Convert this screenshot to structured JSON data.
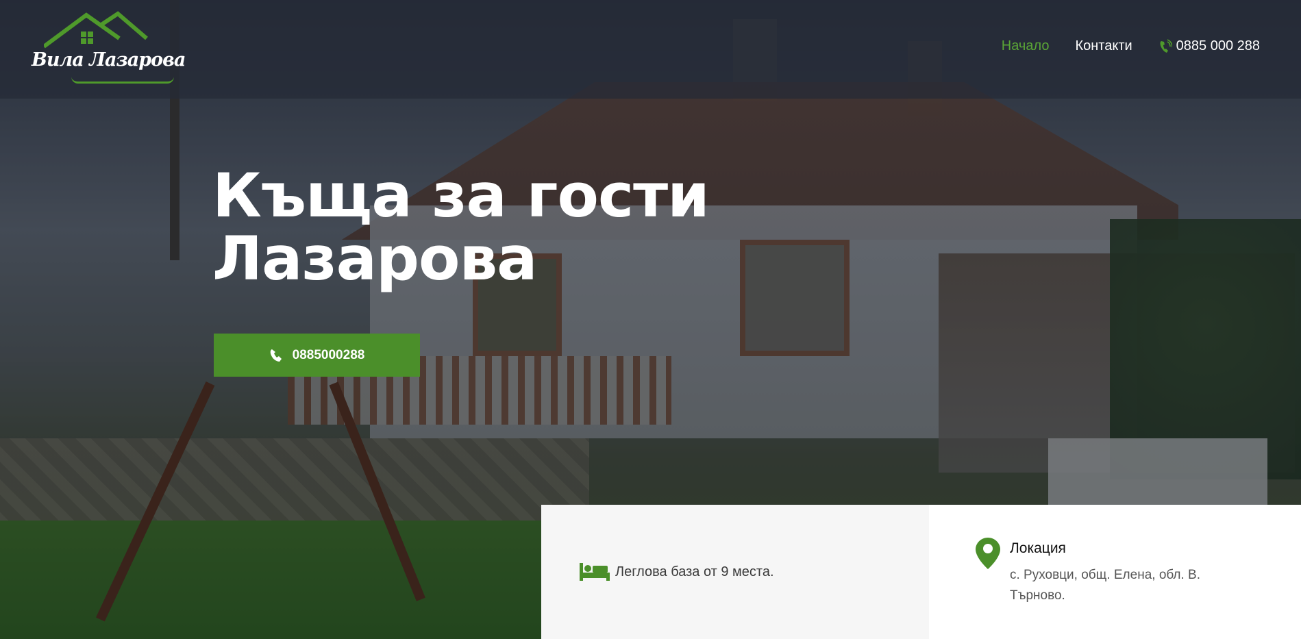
{
  "brand": {
    "logo_text": "Вила Лазарова",
    "accent_color": "#4b8f2a",
    "nav_active_color": "#5aa636"
  },
  "nav": {
    "items": [
      {
        "label": "Начало",
        "active": true
      },
      {
        "label": "Контакти",
        "active": false
      }
    ],
    "phone": "0885 000 288",
    "phone_icon": "phone-ringing-icon"
  },
  "hero": {
    "title": "Къща за гости Лазарова",
    "cta_label": "0885000288",
    "cta_icon": "phone-icon"
  },
  "info": {
    "capacity": {
      "icon": "bed-icon",
      "text": "Леглова база от 9 места."
    },
    "location": {
      "icon": "map-pin-icon",
      "title": "Локация",
      "address": "с. Руховци, общ. Елена, обл. В. Търново."
    }
  }
}
